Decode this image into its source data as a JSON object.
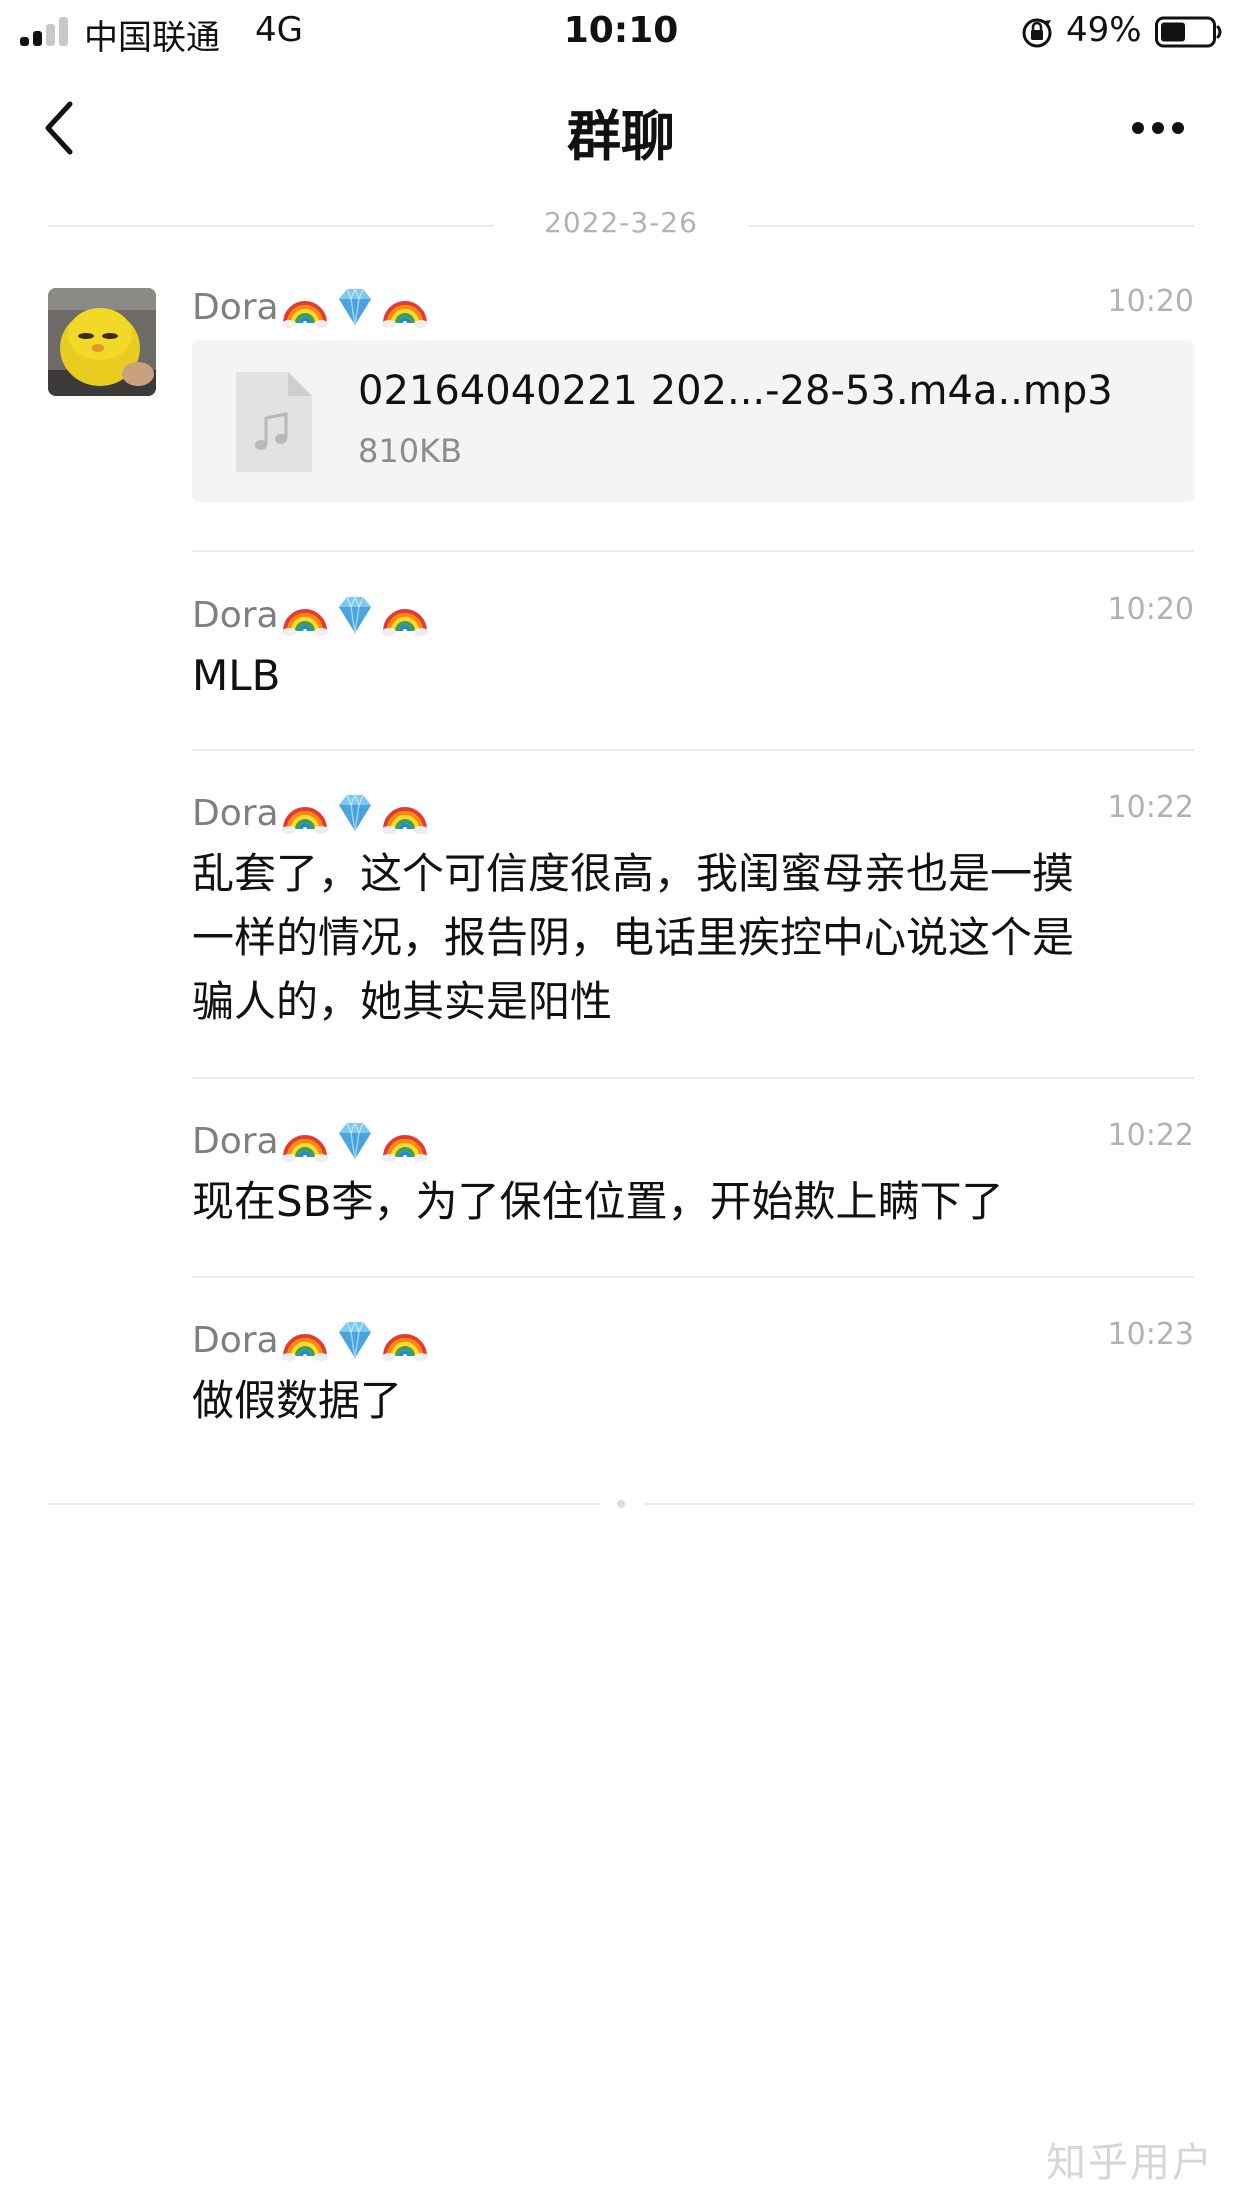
{
  "status_bar": {
    "carrier": "中国联通",
    "network": "4G",
    "time": "10:10",
    "battery": "49%",
    "battery_level": 0.49,
    "icons": [
      "signal-icon",
      "orientation-lock-icon",
      "battery-icon"
    ]
  },
  "nav": {
    "title": "群聊",
    "back_icon": "chevron-left-icon",
    "more_icon": "more-dots-icon"
  },
  "chat": {
    "date": "2022-3-26",
    "sender_emoji": [
      "rainbow",
      "gem",
      "rainbow"
    ],
    "messages": [
      {
        "sender": "Dora",
        "time": "10:20",
        "type": "file",
        "file": {
          "name": "02164040221 202...-28-53.m4a..mp3",
          "size": "810KB",
          "icon": "music-file-icon"
        }
      },
      {
        "sender": "Dora",
        "time": "10:20",
        "type": "text",
        "text": "MLB"
      },
      {
        "sender": "Dora",
        "time": "10:22",
        "type": "text",
        "lines": [
          "乱套了，这个可信度很高，我闺蜜母亲也是一摸",
          "一样的情况，报告阴，电话里疾控中心说这个是",
          "骗人的，她其实是阳性"
        ]
      },
      {
        "sender": "Dora",
        "time": "10:22",
        "type": "text",
        "text": "现在SB李，为了保住位置，开始欺上瞒下了"
      },
      {
        "sender": "Dora",
        "time": "10:23",
        "type": "text",
        "text": "做假数据了"
      }
    ]
  },
  "watermark": "知乎用户",
  "colors": {
    "name_gray": "#7f7f7f",
    "time_gray": "#b2b2b2",
    "divider": "#ececec",
    "file_card_bg": "#f4f4f4"
  }
}
